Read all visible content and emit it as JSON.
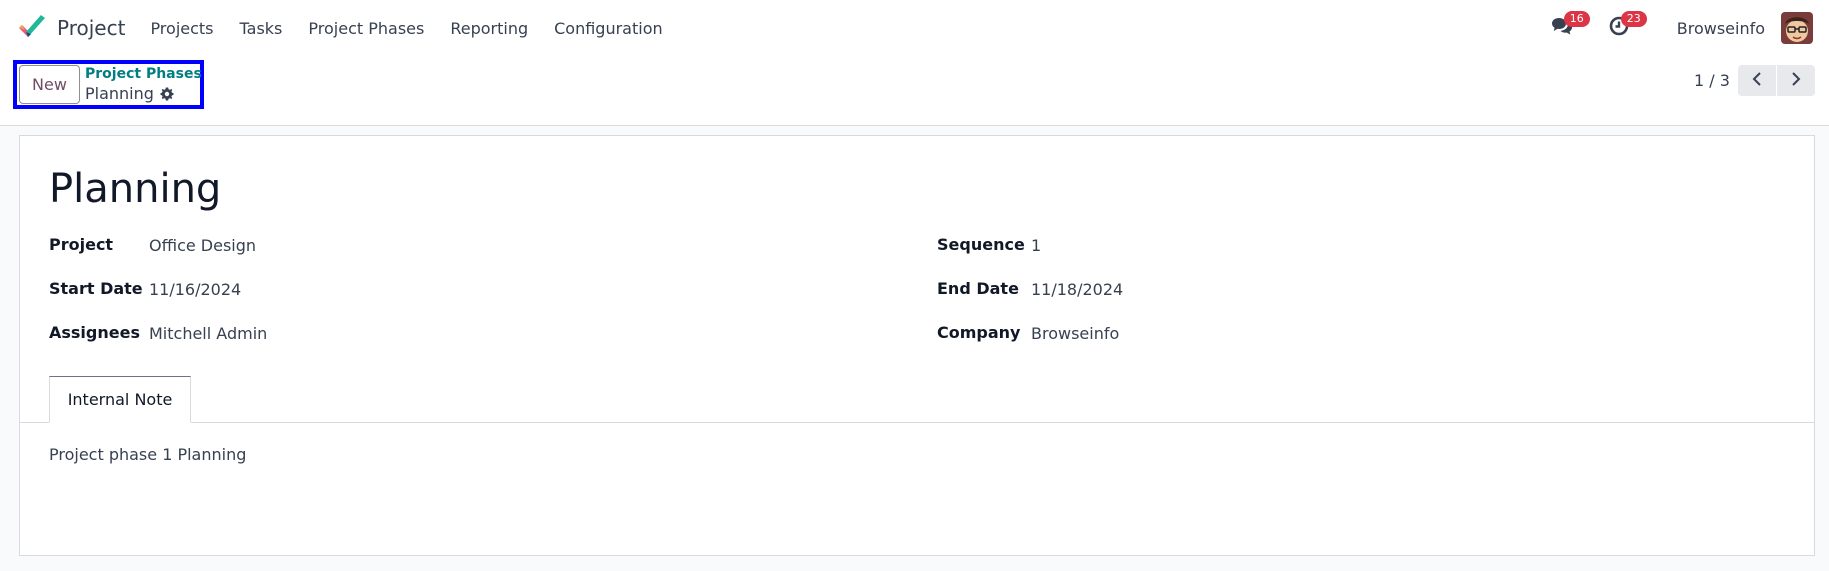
{
  "navbar": {
    "app_name": "Project",
    "menu": [
      "Projects",
      "Tasks",
      "Project Phases",
      "Reporting",
      "Configuration"
    ],
    "messages_count": "16",
    "activities_count": "23",
    "user_name": "Browseinfo",
    "icons": {
      "logo": "odoo-project-check-logo",
      "messages": "chat-bubbles-icon",
      "activities": "clock-icon",
      "avatar": "user-avatar"
    }
  },
  "control_panel": {
    "new_label": "New",
    "breadcrumb_parent": "Project Phases",
    "breadcrumb_current": "Planning",
    "pager": "1 / 3"
  },
  "record": {
    "title": "Planning",
    "fields": {
      "project": {
        "label": "Project",
        "value": "Office Design"
      },
      "start_date": {
        "label": "Start Date",
        "value": "11/16/2024"
      },
      "assignees": {
        "label": "Assignees",
        "value": "Mitchell Admin"
      },
      "sequence": {
        "label": "Sequence",
        "value": "1"
      },
      "end_date": {
        "label": "End Date",
        "value": "11/18/2024"
      },
      "company": {
        "label": "Company",
        "value": "Browseinfo"
      }
    },
    "tabs": [
      "Internal Note"
    ],
    "internal_note": "Project phase 1 Planning"
  },
  "colors": {
    "accent_teal": "#017e84",
    "brand_purple": "#714b67",
    "badge_red": "#dc3545",
    "highlight_blue": "#0000ff"
  }
}
